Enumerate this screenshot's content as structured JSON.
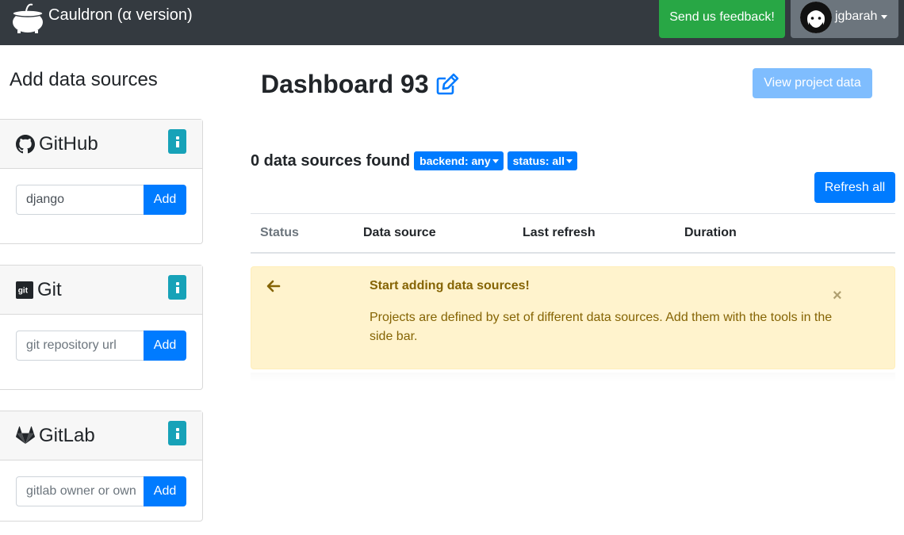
{
  "navbar": {
    "brand": "Cauldron (α version)",
    "logo_icon": "cauldron-logo",
    "feedback_label": "Send us feedback!",
    "user_name": "jgbarah",
    "user_icon": "avatar-icon",
    "colors": {
      "bar": "#343a40",
      "feedback": "#28a745",
      "user": "#6c757d"
    }
  },
  "sidebar": {
    "title": "Add data sources",
    "sources": [
      {
        "name": "GitHub",
        "icon": "github-icon",
        "input_value": "django",
        "placeholder": "",
        "add_label": "Add"
      },
      {
        "name": "Git",
        "icon": "git-icon",
        "input_value": "",
        "placeholder": "git repository url",
        "add_label": "Add"
      },
      {
        "name": "GitLab",
        "icon": "gitlab-icon",
        "input_value": "",
        "placeholder": "gitlab owner or own",
        "add_label": "Add"
      }
    ]
  },
  "main": {
    "title": "Dashboard 93",
    "edit_icon": "edit-icon",
    "view_label": "View project data",
    "count_text": "0 data sources found",
    "filters": {
      "backend": "backend: any",
      "status": "status: all"
    },
    "refresh_label": "Refresh all",
    "table": {
      "columns": [
        "Status",
        "Data source",
        "Last refresh",
        "Duration"
      ]
    },
    "alert": {
      "title": "Start adding data sources!",
      "text": "Projects are defined by set of different data sources. Add them with the tools in the side bar.",
      "close": "×",
      "arrow_icon": "arrow-left-icon",
      "color": "#fff3cd"
    }
  }
}
